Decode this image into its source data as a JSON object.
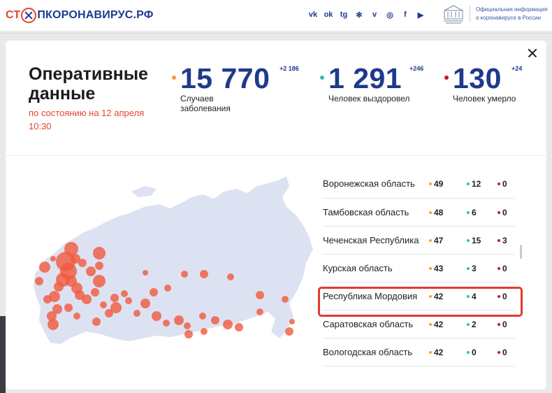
{
  "site": {
    "logo_part1": "СТ",
    "logo_part2": "ПКОРОНАВИРУС.РФ",
    "gov_text": "Официальная информация о коронавирусе в России",
    "socials": [
      {
        "name": "vk-icon",
        "glyph": "vk"
      },
      {
        "name": "odnoklassniki-icon",
        "glyph": "ok"
      },
      {
        "name": "telegram-icon",
        "glyph": "tg"
      },
      {
        "name": "yandex-zen-icon",
        "glyph": "✻"
      },
      {
        "name": "viber-icon",
        "glyph": "v"
      },
      {
        "name": "instagram-icon",
        "glyph": "◎"
      },
      {
        "name": "facebook-icon",
        "glyph": "f"
      },
      {
        "name": "youtube-icon",
        "glyph": "▶"
      }
    ]
  },
  "modal": {
    "title": "Оперативные данные",
    "subtitle": "по состоянию на 12 апреля 10:30",
    "stats": [
      {
        "value": "15 770",
        "delta": "+2 186",
        "label": "Случаев заболевания",
        "color": "#f2a13a"
      },
      {
        "value": "1 291",
        "delta": "+246",
        "label": "Человек выздоровел",
        "color": "#2cc3a6"
      },
      {
        "value": "130",
        "delta": "+24",
        "label": "Человек умерло",
        "color": "#c0182b"
      }
    ],
    "regions": [
      {
        "name": "Воронежская область",
        "cases": "49",
        "recovered": "12",
        "deaths": "0"
      },
      {
        "name": "Тамбовская область",
        "cases": "48",
        "recovered": "6",
        "deaths": "0"
      },
      {
        "name": "Чеченская Республика",
        "cases": "47",
        "recovered": "15",
        "deaths": "3"
      },
      {
        "name": "Курская область",
        "cases": "43",
        "recovered": "3",
        "deaths": "0"
      },
      {
        "name": "Республика Мордовия",
        "cases": "42",
        "recovered": "4",
        "deaths": "0"
      },
      {
        "name": "Саратовская область",
        "cases": "42",
        "recovered": "2",
        "deaths": "0"
      },
      {
        "name": "Вологодская область",
        "cases": "42",
        "recovered": "0",
        "deaths": "0"
      }
    ],
    "colors": {
      "cases": "#f2a13a",
      "recovered": "#2cc3a6",
      "deaths": "#c0182b",
      "map_land": "#dde2f2",
      "map_marker": "#f05a3c",
      "highlight": "#e33a2e"
    }
  }
}
